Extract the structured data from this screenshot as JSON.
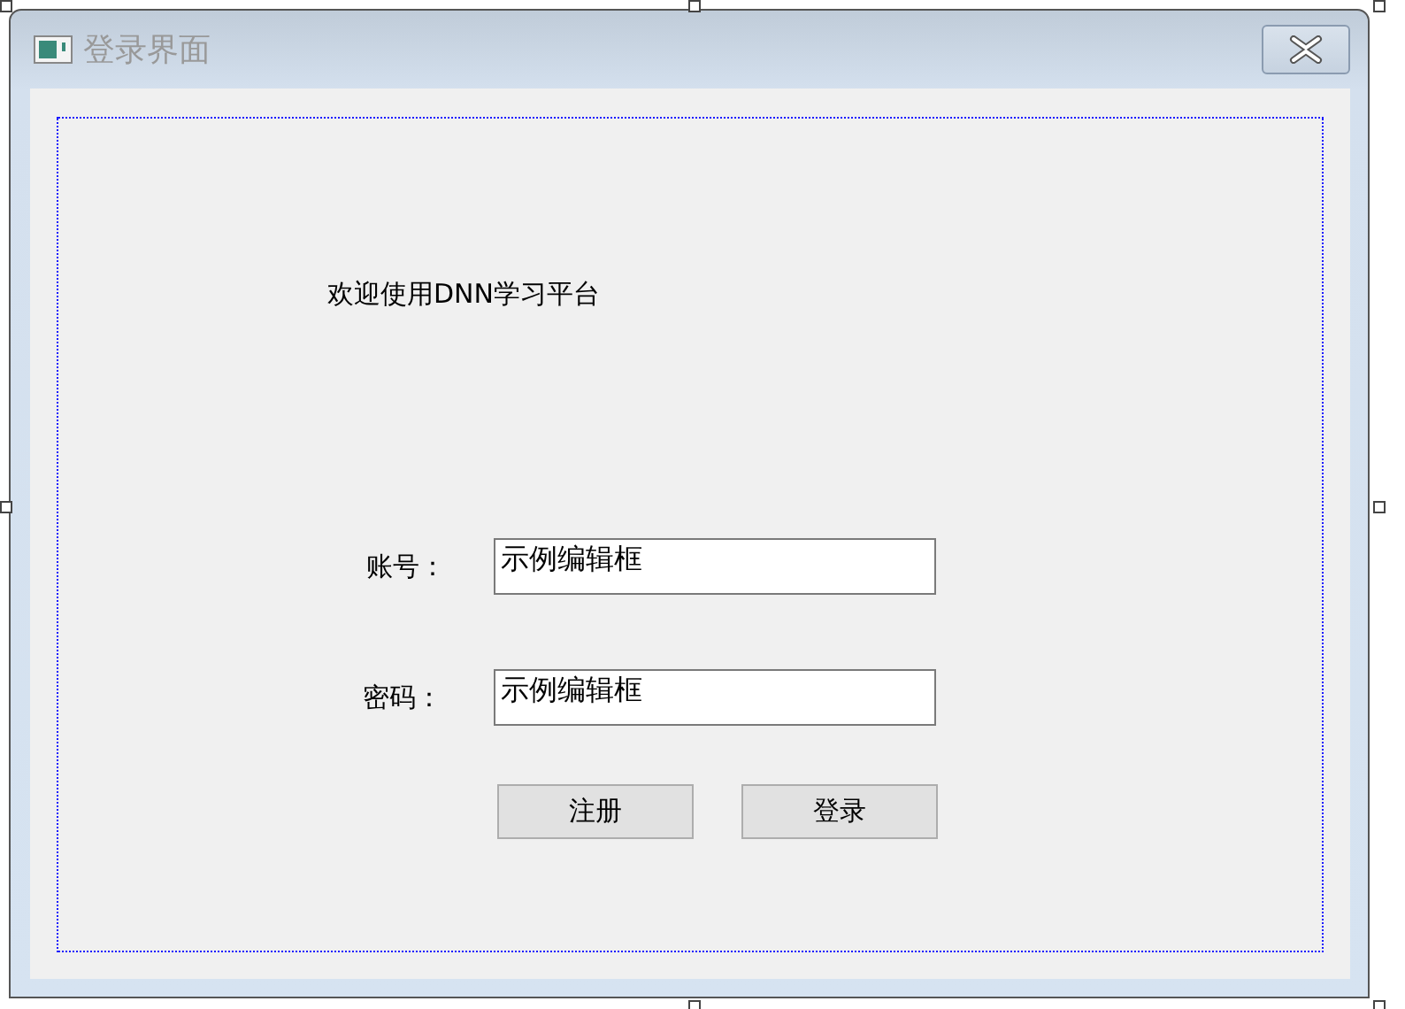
{
  "window": {
    "title": "登录界面"
  },
  "welcome": "欢迎使用DNN学习平台",
  "fields": [
    {
      "label": "账号：",
      "value": "示例编辑框"
    },
    {
      "label": "密码：",
      "value": "示例编辑框"
    }
  ],
  "buttons": [
    "注册",
    "登录"
  ]
}
